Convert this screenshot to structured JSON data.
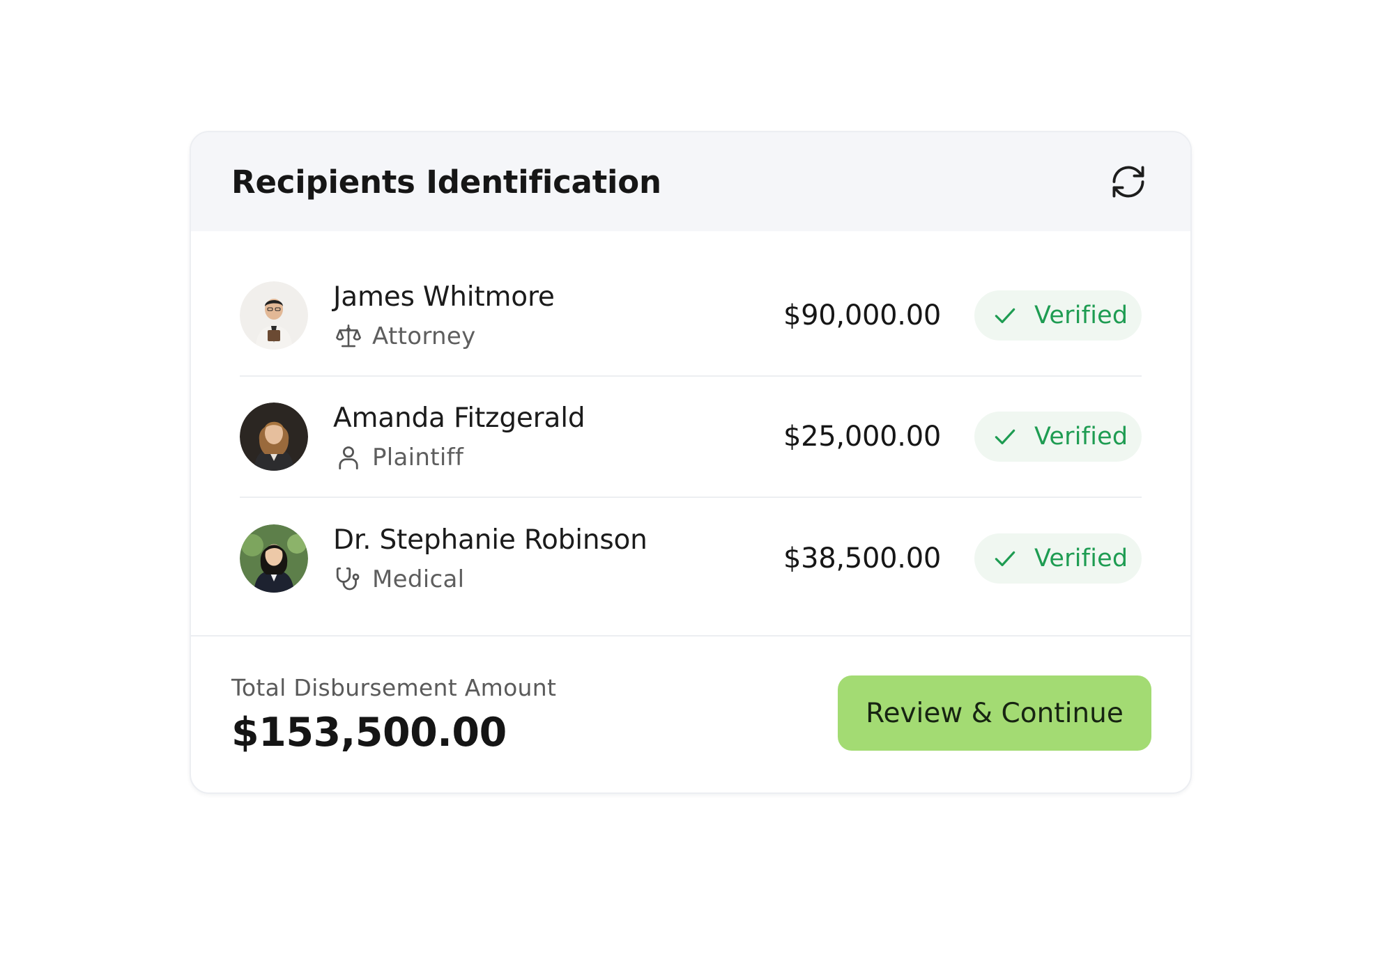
{
  "header": {
    "title": "Recipients Identification",
    "refresh_icon": "refresh-icon"
  },
  "recipients": [
    {
      "name": "James Whitmore",
      "role": "Attorney",
      "role_icon": "scale-icon",
      "amount": "$90,000.00",
      "status": "Verified"
    },
    {
      "name": "Amanda Fitzgerald",
      "role": "Plaintiff",
      "role_icon": "person-icon",
      "amount": "$25,000.00",
      "status": "Verified"
    },
    {
      "name": "Dr. Stephanie Robinson",
      "role": "Medical",
      "role_icon": "stethoscope-icon",
      "amount": "$38,500.00",
      "status": "Verified"
    }
  ],
  "footer": {
    "total_label": "Total Disbursement Amount",
    "total_value": "$153,500.00",
    "cta_label": "Review & Continue"
  },
  "colors": {
    "accent_green": "#a3db73",
    "verified_text": "#1e9c52",
    "verified_bg": "#f0f7f1",
    "header_bg": "#f5f6f9"
  }
}
